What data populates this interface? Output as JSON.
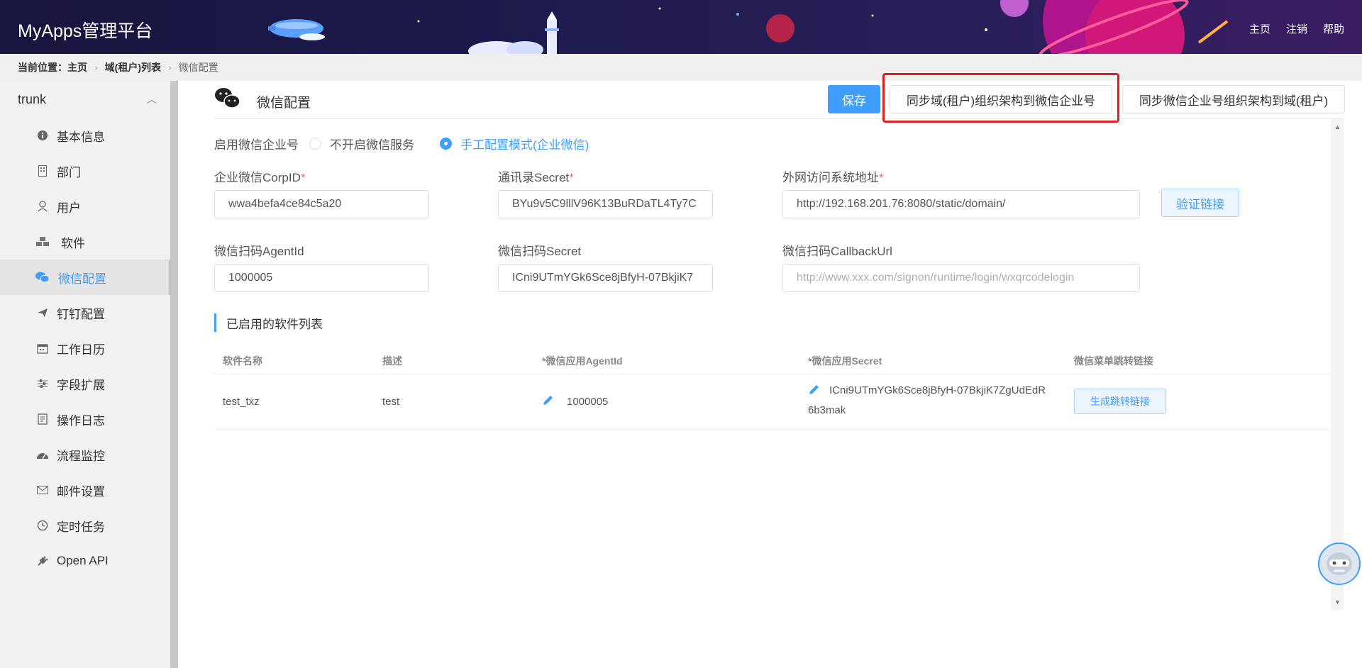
{
  "header": {
    "brand": "MyApps管理平台",
    "nav": [
      "主页",
      "注销",
      "帮助"
    ]
  },
  "breadcrumb": {
    "label": "当前位置：",
    "items": [
      "主页",
      "域(租户)列表",
      "微信配置"
    ]
  },
  "sidebar": {
    "group": "trunk",
    "items": [
      {
        "label": "基本信息",
        "icon": "info-icon"
      },
      {
        "label": "部门",
        "icon": "building-icon"
      },
      {
        "label": "用户",
        "icon": "user-icon"
      },
      {
        "label": "软件",
        "icon": "cubes-icon"
      },
      {
        "label": "微信配置",
        "icon": "wechat-icon"
      },
      {
        "label": "钉钉配置",
        "icon": "plane-icon"
      },
      {
        "label": "工作日历",
        "icon": "calendar-icon"
      },
      {
        "label": "字段扩展",
        "icon": "sliders-icon"
      },
      {
        "label": "操作日志",
        "icon": "log-icon"
      },
      {
        "label": "流程监控",
        "icon": "gauge-icon"
      },
      {
        "label": "邮件设置",
        "icon": "mail-icon"
      },
      {
        "label": "定时任务",
        "icon": "clock-icon"
      },
      {
        "label": "Open API",
        "icon": "plug-icon"
      }
    ],
    "active": "微信配置"
  },
  "page": {
    "title": "微信配置",
    "save": "保存",
    "sync_to_wechat": "同步域(租户)组织架构到微信企业号",
    "sync_from_wechat": "同步微信企业号组织架构到域(租户)"
  },
  "form": {
    "enable_label": "启用微信企业号",
    "radio_off": "不开启微信服务",
    "radio_manual": "手工配置模式(企业微信)",
    "selected": "手工配置模式(企业微信)",
    "corpid_label": "企业微信CorpID",
    "corpid_value": "wwa4befa4ce84c5a20",
    "secret_label": "通讯录Secret",
    "secret_value": "BYu9v5C9lllV96K13BuRDaTL4Ty7C",
    "url_label": "外网访问系统地址",
    "url_value": "http://192.168.201.76:8080/static/domain/",
    "verify": "验证链接",
    "agentid_label": "微信扫码AgentId",
    "agentid_value": "1000005",
    "scan_secret_label": "微信扫码Secret",
    "scan_secret_value": "ICni9UTmYGk6Sce8jBfyH-07BkjiK7",
    "callback_label": "微信扫码CallbackUrl",
    "callback_placeholder": "http://www.xxx.com/signon/runtime/login/wxqrcodelogin"
  },
  "software": {
    "title": "已启用的软件列表",
    "columns": [
      "软件名称",
      "描述",
      "*微信应用AgentId",
      "*微信应用Secret",
      "微信菜单跳转链接"
    ],
    "rows": [
      {
        "name": "test_txz",
        "desc": "test",
        "agentid": "1000005",
        "secret_line1": "ICni9UTmYGk6Sce8jBfyH-07BkjiK7ZgUdEdR",
        "secret_line2": "6b3mak",
        "action": "生成跳转链接"
      }
    ]
  },
  "colors": {
    "accent": "#409eff",
    "header_bg": "#1d1b4d",
    "highlight": "#e02020"
  }
}
